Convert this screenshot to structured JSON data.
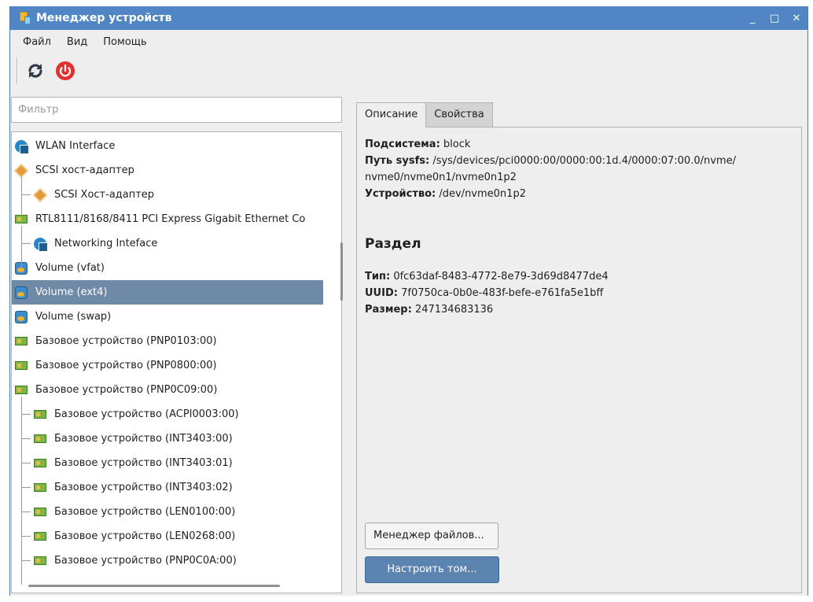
{
  "window": {
    "title": "Менеджер устройств",
    "minimize": "_",
    "maximize": "□",
    "close": "✕"
  },
  "menu": [
    "Файл",
    "Вид",
    "Помощь"
  ],
  "toolbar": {
    "refresh_icon": "refresh-icon",
    "power_icon": "power-icon"
  },
  "filter": {
    "placeholder": "Фильтр"
  },
  "tree": [
    {
      "label": "WLAN Interface",
      "icon": "network-icon",
      "level": 0
    },
    {
      "label": "SCSI хост-адаптер",
      "icon": "scsi-icon",
      "level": 0
    },
    {
      "label": "SCSI Хост-адаптер",
      "icon": "scsi-icon",
      "level": 1
    },
    {
      "label": "RTL8111/8168/8411 PCI Express Gigabit Ethernet Co",
      "icon": "card-icon",
      "level": 0
    },
    {
      "label": "Networking Inteface",
      "icon": "network-icon",
      "level": 1
    },
    {
      "label": "Volume (vfat)",
      "icon": "volume-icon",
      "level": 0
    },
    {
      "label": "Volume (ext4)",
      "icon": "volume-icon",
      "level": 0,
      "selected": true
    },
    {
      "label": "Volume (swap)",
      "icon": "volume-icon",
      "level": 0
    },
    {
      "label": "Базовое устройство (PNP0103:00)",
      "icon": "card-icon",
      "level": 0
    },
    {
      "label": "Базовое устройство (PNP0800:00)",
      "icon": "card-icon",
      "level": 0
    },
    {
      "label": "Базовое устройство (PNP0C09:00)",
      "icon": "card-icon",
      "level": 0
    },
    {
      "label": "Базовое устройство (ACPI0003:00)",
      "icon": "card-icon",
      "level": 1
    },
    {
      "label": "Базовое устройство (INT3403:00)",
      "icon": "card-icon",
      "level": 1
    },
    {
      "label": "Базовое устройство (INT3403:01)",
      "icon": "card-icon",
      "level": 1
    },
    {
      "label": "Базовое устройство (INT3403:02)",
      "icon": "card-icon",
      "level": 1
    },
    {
      "label": "Базовое устройство (LEN0100:00)",
      "icon": "card-icon",
      "level": 1
    },
    {
      "label": "Базовое устройство (LEN0268:00)",
      "icon": "card-icon",
      "level": 1
    },
    {
      "label": "Базовое устройство (PNP0C0A:00)",
      "icon": "card-icon",
      "level": 1
    }
  ],
  "tabs": {
    "description": "Описание",
    "properties": "Свойства"
  },
  "details": {
    "subsystem_label": "Подсистема:",
    "subsystem": "block",
    "sysfs_label": "Путь sysfs:",
    "sysfs_line1": "/sys/devices/pci0000:00/0000:00:1d.4/0000:07:00.0/nvme/",
    "sysfs_line2": "nvme0/nvme0n1/nvme0n1p2",
    "device_label": "Устройство:",
    "device": "/dev/nvme0n1p2",
    "section_title": "Раздел",
    "type_label": "Тип:",
    "type": "0fc63daf-8483-4772-8e79-3d69d8477de4",
    "uuid_label": "UUID:",
    "uuid": "7f0750ca-0b0e-483f-befe-e761fa5e1bff",
    "size_label": "Размер:",
    "size": "247134683136"
  },
  "buttons": {
    "file_manager": "Менеджер файлов...",
    "configure_volume": "Настроить том..."
  },
  "colors": {
    "titlebar": "#4f86c3",
    "selection": "#6e8aa6",
    "primary_button": "#5b84b1",
    "refresh": "#2f3a48",
    "power": "#e0322e"
  }
}
